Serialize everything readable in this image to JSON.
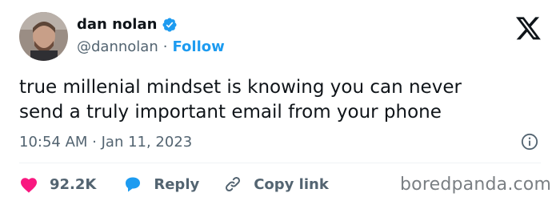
{
  "author": {
    "name": "dan nolan",
    "handle": "@dannolan",
    "separator": "·",
    "follow_label": "Follow",
    "verified": true
  },
  "tweet": {
    "text": "true millenial mindset is knowing you can never\nsend a truly important email from your phone",
    "timestamp": "10:54 AM · Jan 11, 2023"
  },
  "actions": {
    "likes": "92.2K",
    "reply_label": "Reply",
    "copy_link_label": "Copy link"
  },
  "watermark": "boredpanda.com",
  "icons": {
    "brand": "x-logo-icon",
    "verified": "verified-badge-icon",
    "info": "info-icon",
    "like": "heart-icon",
    "reply": "speech-bubble-icon",
    "copy_link": "link-icon"
  },
  "colors": {
    "accent": "#1d9bf0",
    "like": "#f91880",
    "text_primary": "#0f1419",
    "text_secondary": "#536471"
  }
}
